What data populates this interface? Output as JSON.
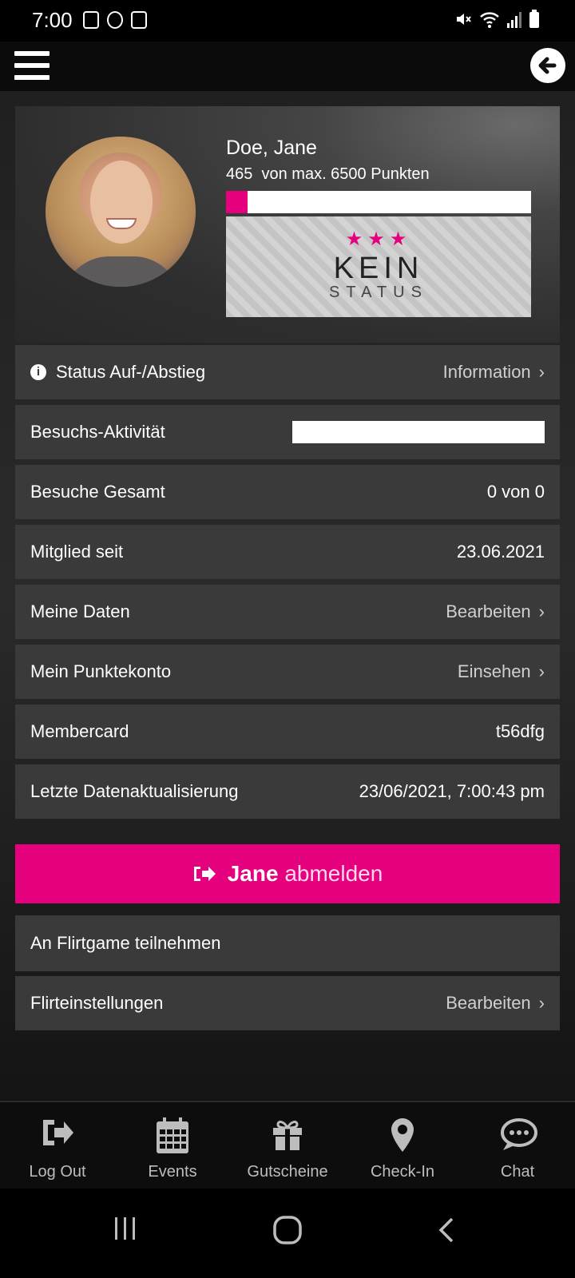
{
  "statusbar": {
    "time": "7:00"
  },
  "profile": {
    "name": "Doe, Jane",
    "points_text": "465  von max. 6500 Punkten",
    "points": 465,
    "points_max": 6500,
    "progress_fraction": 0.0715,
    "status_title": "KEIN",
    "status_subtitle": "STATUS",
    "stars": "★★★"
  },
  "rows": [
    {
      "label": "Status Auf-/Abstieg",
      "value": "Information",
      "chevron": "›"
    },
    {
      "label": "Besuchs-Aktivität"
    },
    {
      "label": "Besuche Gesamt",
      "value": "0 von 0"
    },
    {
      "label": "Mitglied seit",
      "value": "23.06.2021"
    },
    {
      "label": "Meine Daten",
      "value": "Bearbeiten",
      "chevron": "›"
    },
    {
      "label": "Mein Punktekonto",
      "value": "Einsehen",
      "chevron": "›"
    },
    {
      "label": "Membercard",
      "value": "t56dfg"
    },
    {
      "label": "Letzte Datenaktualisierung",
      "value": "23/06/2021, 7:00:43 pm"
    }
  ],
  "logout": {
    "name": "Jane",
    "action": "abmelden"
  },
  "flirt_rows": [
    {
      "label": "An Flirtgame teilnehmen"
    },
    {
      "label": "Flirteinstellungen",
      "value": "Bearbeiten",
      "chevron": "›"
    }
  ],
  "bottom_nav": [
    {
      "label": "Log Out",
      "icon": "logout-icon"
    },
    {
      "label": "Events",
      "icon": "calendar-icon"
    },
    {
      "label": "Gutscheine",
      "icon": "gift-icon"
    },
    {
      "label": "Check-In",
      "icon": "location-pin-icon"
    },
    {
      "label": "Chat",
      "icon": "chat-icon"
    }
  ],
  "colors": {
    "accent": "#e5007e",
    "background": "#161616",
    "row": "#3a3a3a"
  }
}
